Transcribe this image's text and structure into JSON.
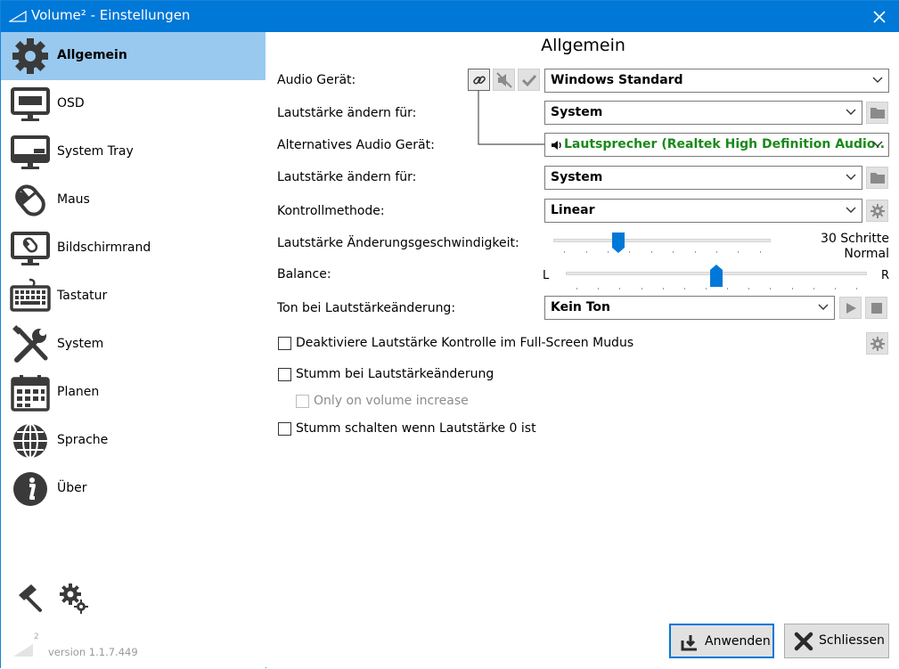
{
  "window": {
    "title": "Volume² - Einstellungen",
    "logo": "volume-triangle-icon",
    "close_icon": "close-icon"
  },
  "sidebar": {
    "items": [
      {
        "label": "Allgemein",
        "icon": "gear-icon",
        "active": true
      },
      {
        "label": "OSD",
        "icon": "monitor-osd-icon"
      },
      {
        "label": "System Tray",
        "icon": "monitor-tray-icon"
      },
      {
        "label": "Maus",
        "icon": "mouse-icon"
      },
      {
        "label": "Bildschirmrand",
        "icon": "monitor-edge-icon"
      },
      {
        "label": "Tastatur",
        "icon": "keyboard-icon"
      },
      {
        "label": "System",
        "icon": "tools-icon"
      },
      {
        "label": "Planen",
        "icon": "calendar-icon"
      },
      {
        "label": "Sprache",
        "icon": "globe-icon"
      },
      {
        "label": "Über",
        "icon": "info-icon"
      }
    ],
    "footer_icons": [
      "paint-roller-icon",
      "settings-gears-icon"
    ],
    "logo_sup": "2",
    "version": "version 1.1.7.449"
  },
  "main": {
    "heading": "Allgemein",
    "audio_device_label": "Audio Gerät:",
    "audio_device_value": "Windows Standard",
    "volume_for_label_1": "Lautstärke ändern für:",
    "volume_for_value_1": "System",
    "alt_device_label": "Alternatives Audio Gerät:",
    "alt_device_value": "Lautsprecher (Realtek High Definition Audio..",
    "alt_device_color": "#1a8a1a",
    "volume_for_label_2": "Lautstärke ändern für:",
    "volume_for_value_2": "System",
    "control_method_label": "Kontrollmethode:",
    "control_method_value": "Linear",
    "speed_label": "Lautstärke Änderungsgeschwindigkeit:",
    "speed_value": "30 Schritte",
    "speed_desc": "Normal",
    "speed_fraction": 0.3,
    "balance_label": "Balance:",
    "balance_left": "L",
    "balance_right": "R",
    "balance_fraction": 0.5,
    "sound_label": "Ton bei Lautstärkeänderung:",
    "sound_value": "Kein Ton",
    "cb_fullscreen": "Deaktiviere Lautstärke Kontrolle im Full-Screen Mudus",
    "cb_mute_change": "Stumm bei Lautstärkeänderung",
    "cb_only_increase": "Only on volume increase",
    "cb_mute_zero": "Stumm schalten wenn Lautstärke 0 ist"
  },
  "footer": {
    "apply_label": "Anwenden",
    "close_label": "Schliessen"
  },
  "colors": {
    "titlebar": "#0078d7",
    "active_nav": "#99c9ef",
    "icon_dark": "#3a3a3a"
  }
}
